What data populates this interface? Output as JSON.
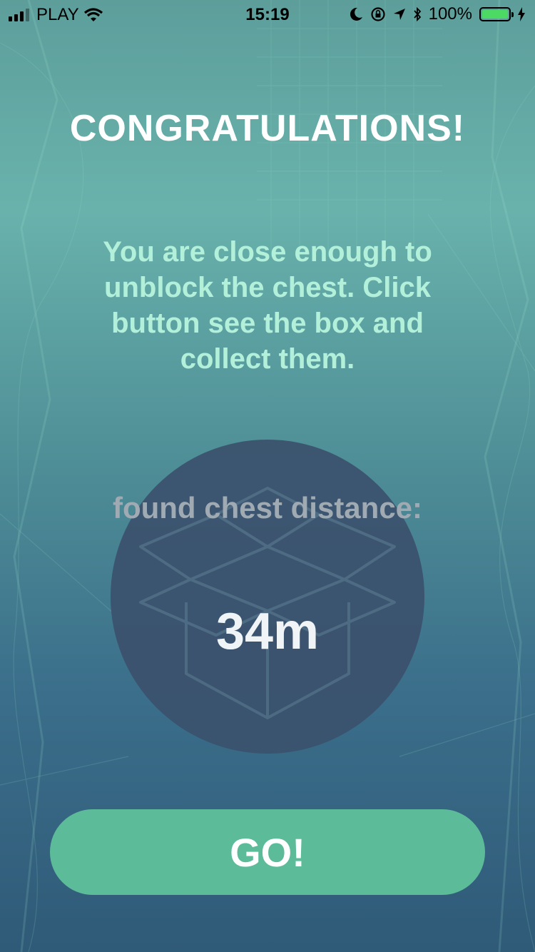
{
  "status_bar": {
    "carrier": "PLAY",
    "time": "15:19",
    "battery_percent": "100%",
    "battery_level": 1.0,
    "battery_color": "#4cd964",
    "icons": [
      "signal-icon",
      "wifi-icon",
      "moon-icon",
      "orientation-lock-icon",
      "location-arrow-icon",
      "bluetooth-icon",
      "battery-icon",
      "charging-bolt-icon"
    ]
  },
  "main": {
    "title": "CONGRATULATIONS!",
    "message": "You are close enough to unblock the chest. Click button see the box and collect them.",
    "found_label": "found  chest distance:",
    "distance": "34m",
    "background_icon": "open-box-icon"
  },
  "actions": {
    "go_label": "GO!"
  },
  "colors": {
    "accent": "#5cbb98",
    "message_text": "#b3f0da",
    "circle": "#3b516d"
  }
}
